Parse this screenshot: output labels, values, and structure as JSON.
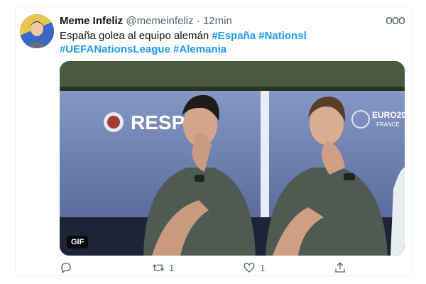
{
  "tweet": {
    "author_name": "Meme Infeliz",
    "author_handle": "@memeinfeliz",
    "separator": "·",
    "time": "12min",
    "more": "ooo",
    "text_plain": "España golea al equipo alemán",
    "hashtags": [
      "#España",
      "#Nationsl",
      "#UEFANationsLeague",
      "#Alemania"
    ],
    "media": {
      "badge": "GIF",
      "banner_text": "RESP",
      "euro_logo_line1": "EURO20",
      "euro_logo_line2": "FRANCE"
    },
    "actions": {
      "reply_count": "",
      "retweet_count": "1",
      "like_count": "1"
    }
  },
  "icons": [
    "reply-icon",
    "retweet-icon",
    "like-icon",
    "share-icon"
  ],
  "colors": {
    "link": "#1d9bf0",
    "muted": "#536471",
    "text": "#0f1419"
  }
}
